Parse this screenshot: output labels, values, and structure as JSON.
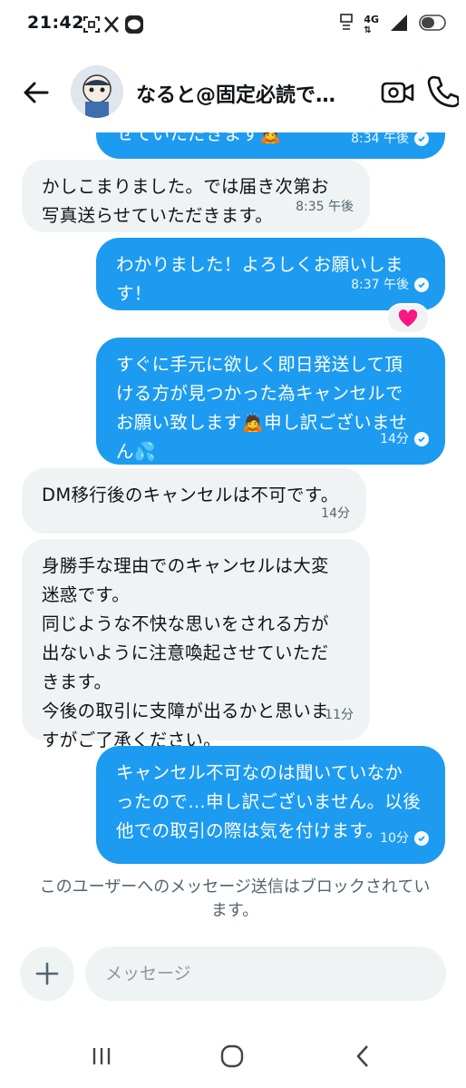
{
  "status_bar": {
    "time": "21:42",
    "left_icons": [
      "scan-icon",
      "x-logo-icon",
      "line-app-icon"
    ],
    "network": "4G",
    "right_icons": [
      "mute-icon",
      "signal-icon",
      "battery-icon"
    ]
  },
  "header": {
    "back_icon": "arrow-left-icon",
    "title": "なると@固定必読で…",
    "video_icon": "video-call-icon",
    "call_icon": "phone-icon"
  },
  "messages": [
    {
      "direction": "sent",
      "text": "せていただきます🙇",
      "time": "8:34 午後",
      "read": true
    },
    {
      "direction": "received",
      "text": "かしこまりました。では届き次第お\n写真送らせていただきます。",
      "time": "8:35 午後"
    },
    {
      "direction": "sent",
      "text": "わかりました！よろしくお願いしま\nす！",
      "time": "8:37 午後",
      "read": true,
      "reaction": "❤️"
    },
    {
      "direction": "sent",
      "text": "すぐに手元に欲しく即日発送して頂\nける方が見つかった為キャンセルで\nお願い致します🙇申し訳ございませ\nん💦",
      "time": "14分",
      "read": true
    },
    {
      "direction": "received",
      "text": "DM移行後のキャンセルは不可です。",
      "time": "14分"
    },
    {
      "direction": "received",
      "text": "身勝手な理由でのキャンセルは大変\n迷惑です。\n同じような不快な思いをされる方が\n出ないように注意喚起させていただ\nきます。\n今後の取引に支障が出るかと思いま\nすがご了承ください。",
      "time": "11分"
    },
    {
      "direction": "sent",
      "text": "キャンセル不可なのは聞いていなか\nったので…申し訳ございません。以後\n他での取引の際は気を付けます。",
      "time": "10分",
      "read": true
    }
  ],
  "blocked_notice": "このユーザーへのメッセージ送信はブロックされてい\nます。",
  "composer": {
    "add_icon": "plus-icon",
    "placeholder": "メッセージ"
  },
  "nav_bar": {
    "icons": [
      "recent-apps-icon",
      "home-icon",
      "back-icon"
    ]
  },
  "colors": {
    "sent_bubble": "#1d9bf0",
    "received_bubble": "#eff3f4",
    "reaction_heart": "#f91880"
  }
}
